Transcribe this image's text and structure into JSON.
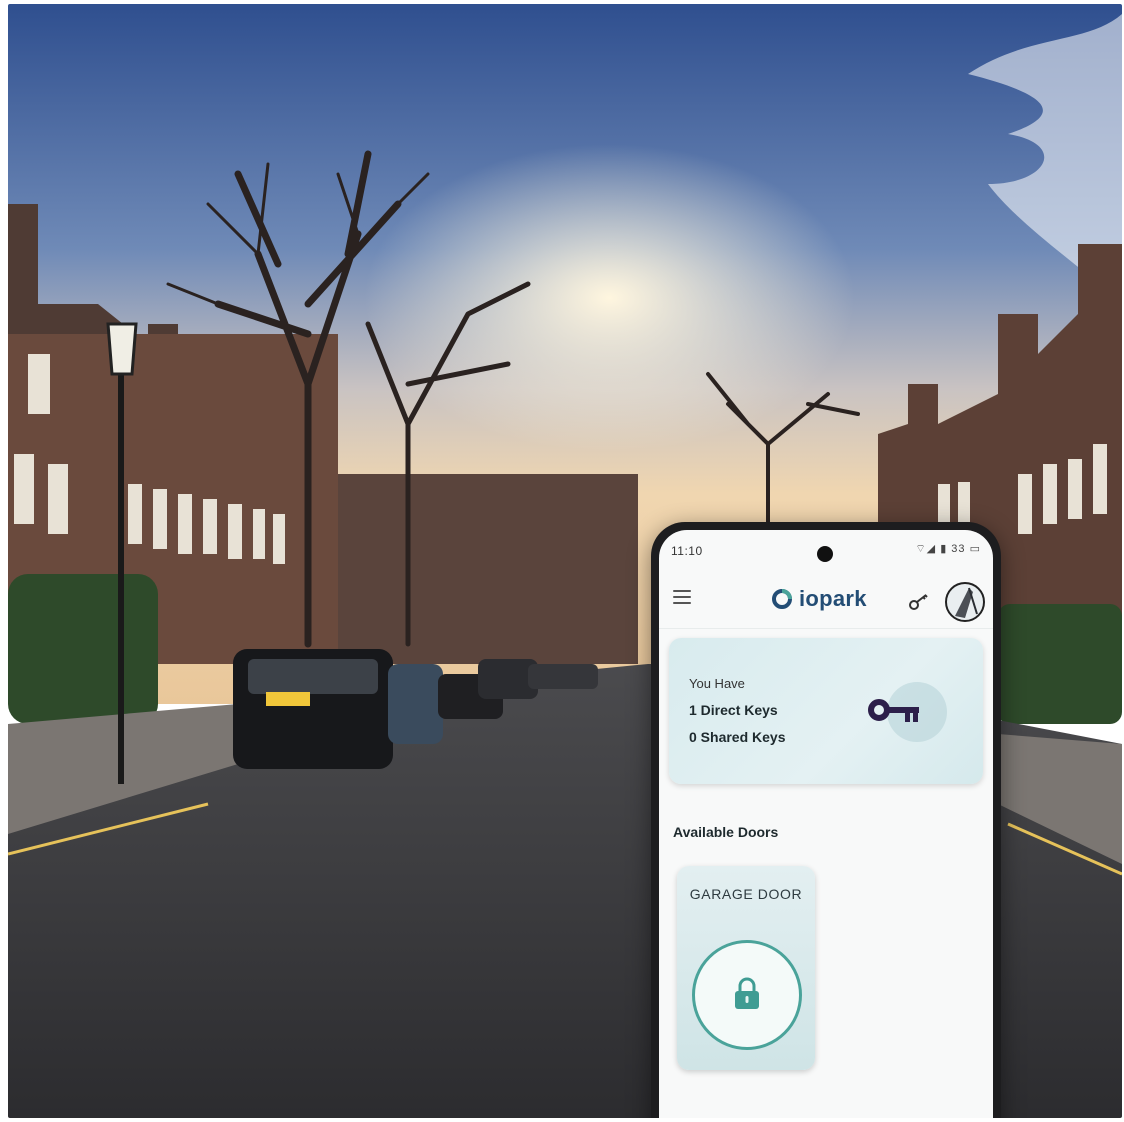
{
  "phone": {
    "status": {
      "time": "11:10",
      "icons": "⌔◢ ▮ 33 ▭"
    },
    "app": {
      "logo_text": "iopark"
    },
    "keys_card": {
      "title": "You Have",
      "direct_keys": "1 Direct Keys",
      "shared_keys": "0 Shared Keys"
    },
    "doors": {
      "section_label": "Available Doors",
      "items": [
        {
          "name": "GARAGE DOOR",
          "state": "locked"
        }
      ]
    },
    "colors": {
      "accent": "#4aa39a",
      "brand": "#234d75",
      "key": "#2c1f4a"
    },
    "icons": [
      "menu-icon",
      "logo-icon",
      "key-icon",
      "avatar",
      "lock-icon"
    ]
  }
}
